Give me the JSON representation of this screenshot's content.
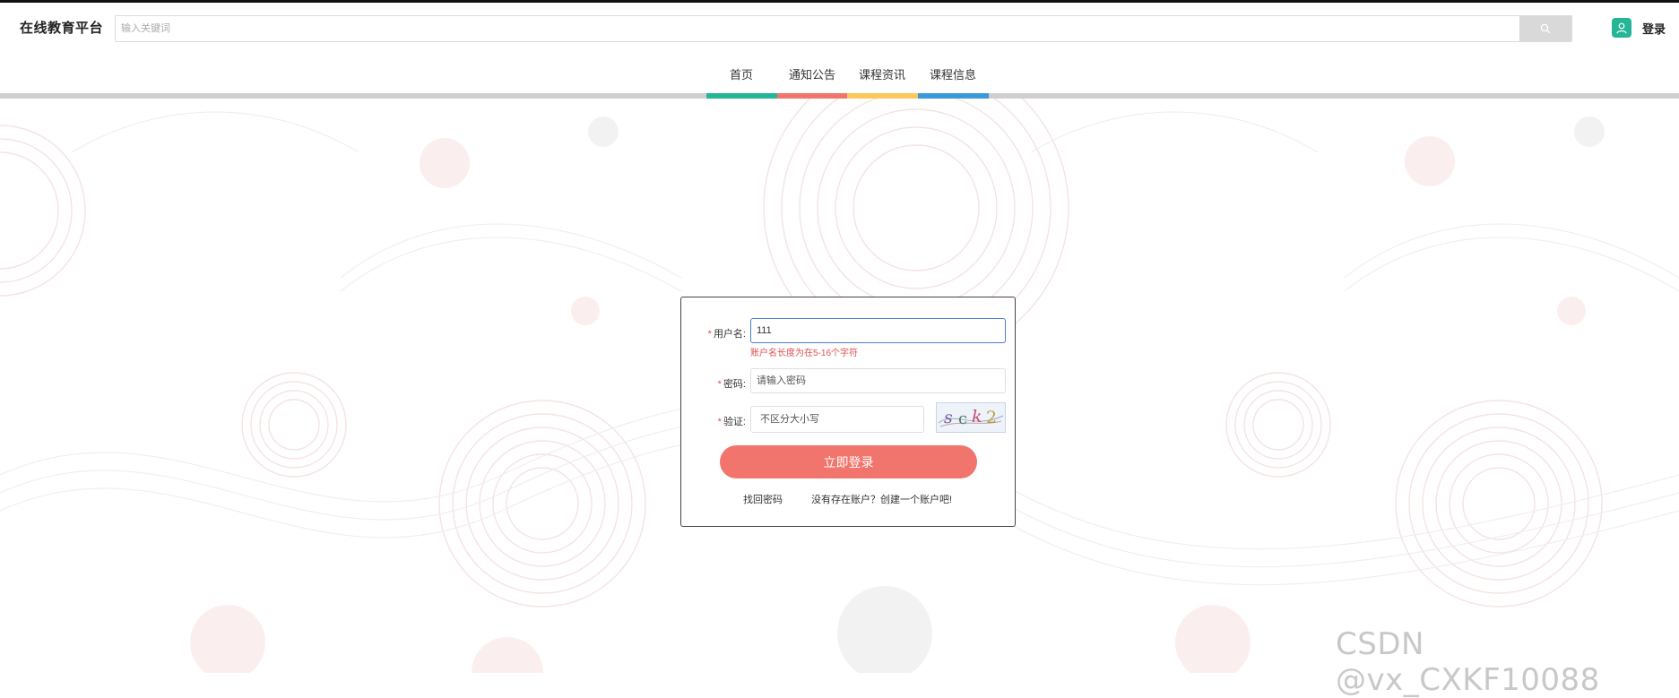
{
  "header": {
    "brand": "在线教育平台",
    "search_placeholder": "输入关键词",
    "search_icon": "search-icon",
    "user_icon": "user-icon",
    "login_label": "登录"
  },
  "nav": {
    "items": [
      {
        "label": "首页",
        "color": "#26b596"
      },
      {
        "label": "通知公告",
        "color": "#f1756c"
      },
      {
        "label": "课程资讯",
        "color": "#fcc75c"
      },
      {
        "label": "课程信息",
        "color": "#3a9ad9"
      }
    ]
  },
  "form": {
    "username_label": "用户名:",
    "username_value": "111",
    "username_error": "账户名长度为在5-16个字符",
    "password_label": "密码:",
    "password_placeholder": "请输入密码",
    "captcha_label": "验证:",
    "captcha_placeholder": "不区分大小写",
    "captcha_text": "sck2",
    "submit_label": "立即登录",
    "forgot_label": "找回密码",
    "register_label": "没有存在账户？创建一个账户吧!"
  },
  "watermark": "CSDN @vx_CXKF10088",
  "colors": {
    "accent": "#f1756c",
    "brand_green": "#26b596",
    "error": "#e05050",
    "focus_border": "#4a7fd6"
  }
}
